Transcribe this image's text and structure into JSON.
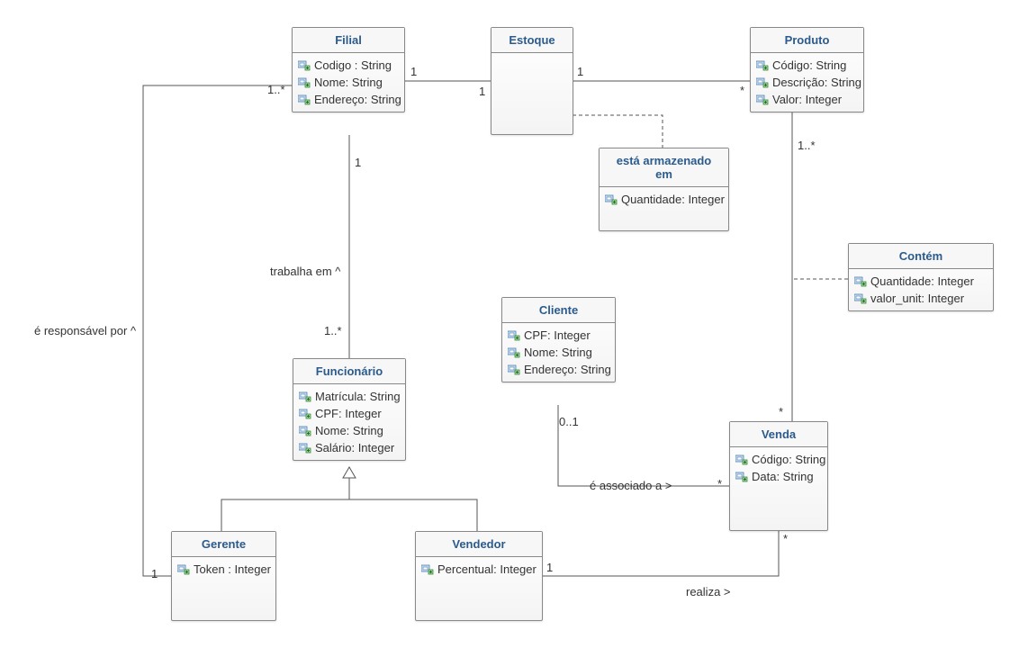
{
  "classes": {
    "filial": {
      "title": "Filial",
      "attrs": [
        "Codigo : String",
        "Nome: String",
        "Endereço: String"
      ]
    },
    "estoque": {
      "title": "Estoque",
      "attrs": []
    },
    "produto": {
      "title": "Produto",
      "attrs": [
        "Código: String",
        "Descrição: String",
        "Valor: Integer"
      ]
    },
    "armazenado": {
      "title": "está armazenado em",
      "attrs": [
        "Quantidade: Integer"
      ]
    },
    "contem": {
      "title": "Contém",
      "attrs": [
        "Quantidade: Integer",
        "valor_unit: Integer"
      ]
    },
    "funcionario": {
      "title": "Funcionário",
      "attrs": [
        "Matrícula: String",
        "CPF: Integer",
        "Nome: String",
        "Salário: Integer"
      ]
    },
    "cliente": {
      "title": "Cliente",
      "attrs": [
        "CPF: Integer",
        "Nome: String",
        "Endereço: String"
      ]
    },
    "venda": {
      "title": "Venda",
      "attrs": [
        "Código: String",
        "Data: String"
      ]
    },
    "gerente": {
      "title": "Gerente",
      "attrs": [
        "Token : Integer"
      ]
    },
    "vendedor": {
      "title": "Vendedor",
      "attrs": [
        "Percentual: Integer"
      ]
    }
  },
  "labels": {
    "responsavel": "é responsável por ^",
    "trabalha": "trabalha em ^",
    "associado": "é associado a >",
    "realiza": "realiza >"
  },
  "mult": {
    "m1star_a": "1..*",
    "m1_a": "1",
    "m1_b": "1",
    "m1_c": "1",
    "mstar_a": "*",
    "m1star_b": "1..*",
    "m1_d": "1",
    "m1star_c": "1..*",
    "m0_1": "0..1",
    "mstar_b": "*",
    "mstar_c": "*",
    "mstar_d": "*",
    "m1_e": "1",
    "m1_f": "1"
  }
}
